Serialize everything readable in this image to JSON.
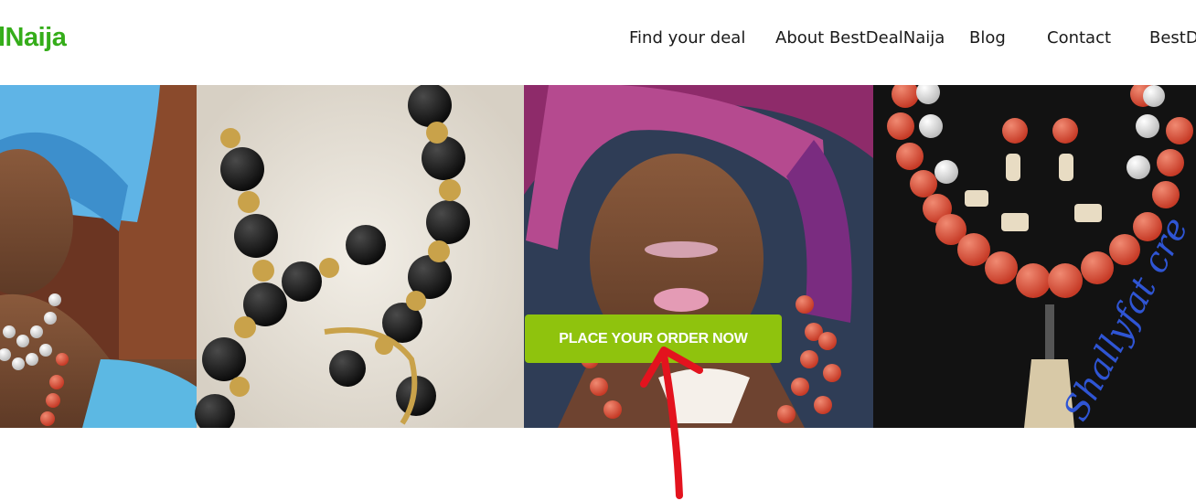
{
  "logo": {
    "text": "lNaija"
  },
  "nav": {
    "items": [
      {
        "label": "Find your deal"
      },
      {
        "label": "About BestDealNaija"
      },
      {
        "label": "Blog"
      },
      {
        "label": "Contact"
      },
      {
        "label": "BestDe"
      }
    ]
  },
  "hero": {
    "cta_label": "PLACE YOUR ORDER NOW",
    "watermark": "Shallyfat cre"
  },
  "colors": {
    "brand_green": "#35ad1a",
    "cta_green": "#8fc30d",
    "annotation_red": "#e3131e"
  }
}
